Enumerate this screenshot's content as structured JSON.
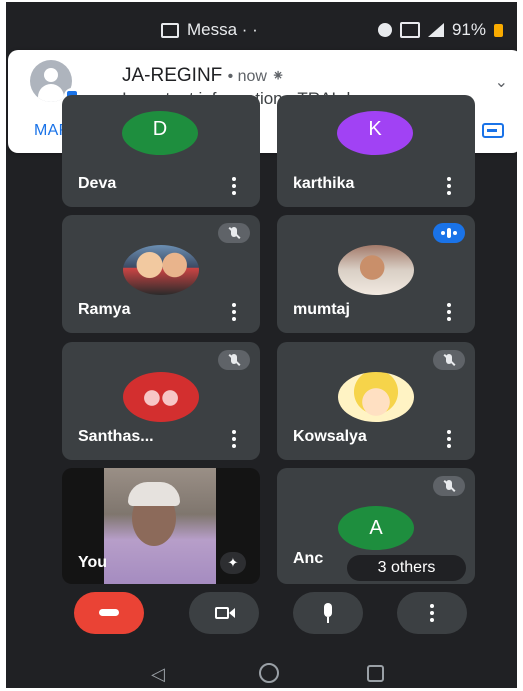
{
  "status_bar": {
    "app_label": "Messa · ·",
    "battery": "91%"
  },
  "notification": {
    "sender": "JA-REGINF",
    "meta": "• now ⁕",
    "message": "Important information - TRAI d...",
    "action": "MARK AS READ",
    "icons": [
      "messages-icon",
      "alarm-icon",
      "sim-icon",
      "signal-icon",
      "battery-icon"
    ]
  },
  "participants": [
    {
      "name": "Deva",
      "avatar_letter": "D",
      "avatar_color": "#1e8e3e"
    },
    {
      "name": "karthika",
      "avatar_letter": "K",
      "avatar_color": "#a142f4"
    },
    {
      "name": "Ramya",
      "state": "muted"
    },
    {
      "name": "mumtaj",
      "state": "speaking"
    },
    {
      "name": "Santhas...",
      "state": "muted"
    },
    {
      "name": "Kowsalya",
      "state": "muted"
    },
    {
      "name": "You"
    },
    {
      "name": "Anc",
      "avatar_letter": "A",
      "avatar_color": "#1e8e3e",
      "state": "muted"
    }
  ],
  "overflow_label": "3 others",
  "colors": {
    "background": "#202124",
    "tile": "#3c4043",
    "end_call": "#ea4335",
    "accent": "#1a73e8"
  }
}
